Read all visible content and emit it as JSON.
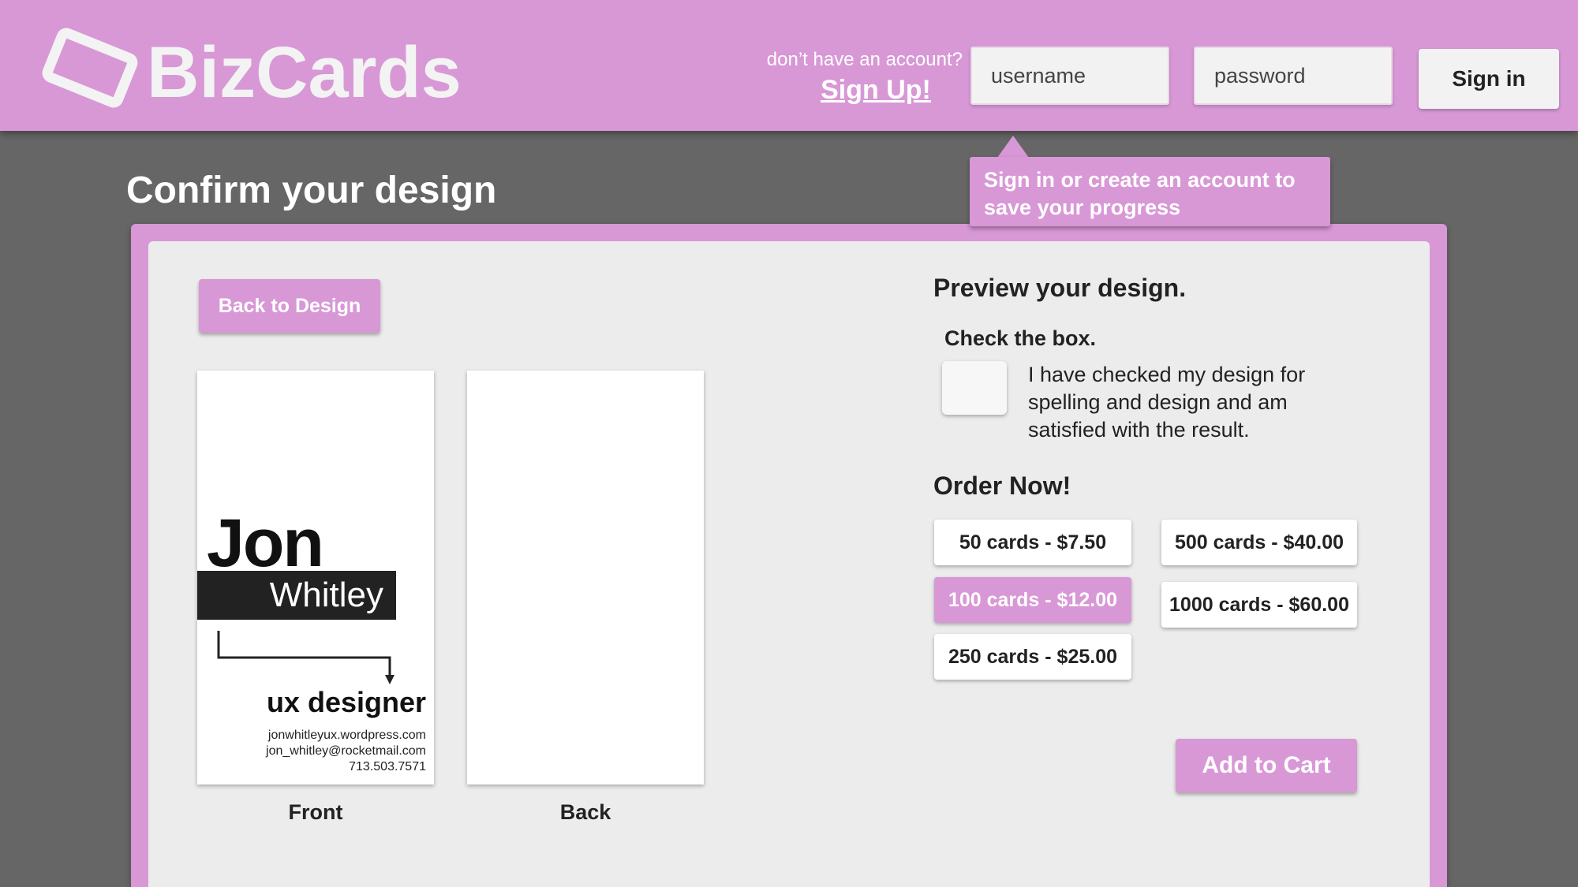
{
  "brand": {
    "name": "BizCards",
    "accent_color": "#d898d6",
    "background_color": "#666666",
    "panel_color": "#ececec"
  },
  "header": {
    "account_prompt": "don’t have an account?",
    "signup_link": "Sign Up!",
    "username_placeholder": "username",
    "password_placeholder": "password",
    "signin_label": "Sign in"
  },
  "tooltip": {
    "text": "Sign in or create an account to save your progress"
  },
  "page": {
    "title": "Confirm your design",
    "back_button": "Back to Design"
  },
  "card_front": {
    "first_name": "Jon",
    "last_name": "Whitley",
    "role": "ux designer",
    "website": "jonwhitleyux.wordpress.com",
    "email": "jon_whitley@rocketmail.com",
    "phone": "713.503.7571"
  },
  "captions": {
    "front": "Front",
    "back": "Back"
  },
  "preview": {
    "title": "Preview your design.",
    "check_title": "Check the box.",
    "check_text": "I have checked my design for spelling  and design and am satisfied with the result.",
    "checked": false
  },
  "order": {
    "title": "Order Now!",
    "options": [
      {
        "label": "50 cards - $7.50",
        "selected": false
      },
      {
        "label": "100 cards - $12.00",
        "selected": true
      },
      {
        "label": "250 cards - $25.00",
        "selected": false
      },
      {
        "label": "500 cards - $40.00",
        "selected": false
      },
      {
        "label": "1000 cards - $60.00",
        "selected": false
      }
    ],
    "add_to_cart": "Add to Cart"
  }
}
